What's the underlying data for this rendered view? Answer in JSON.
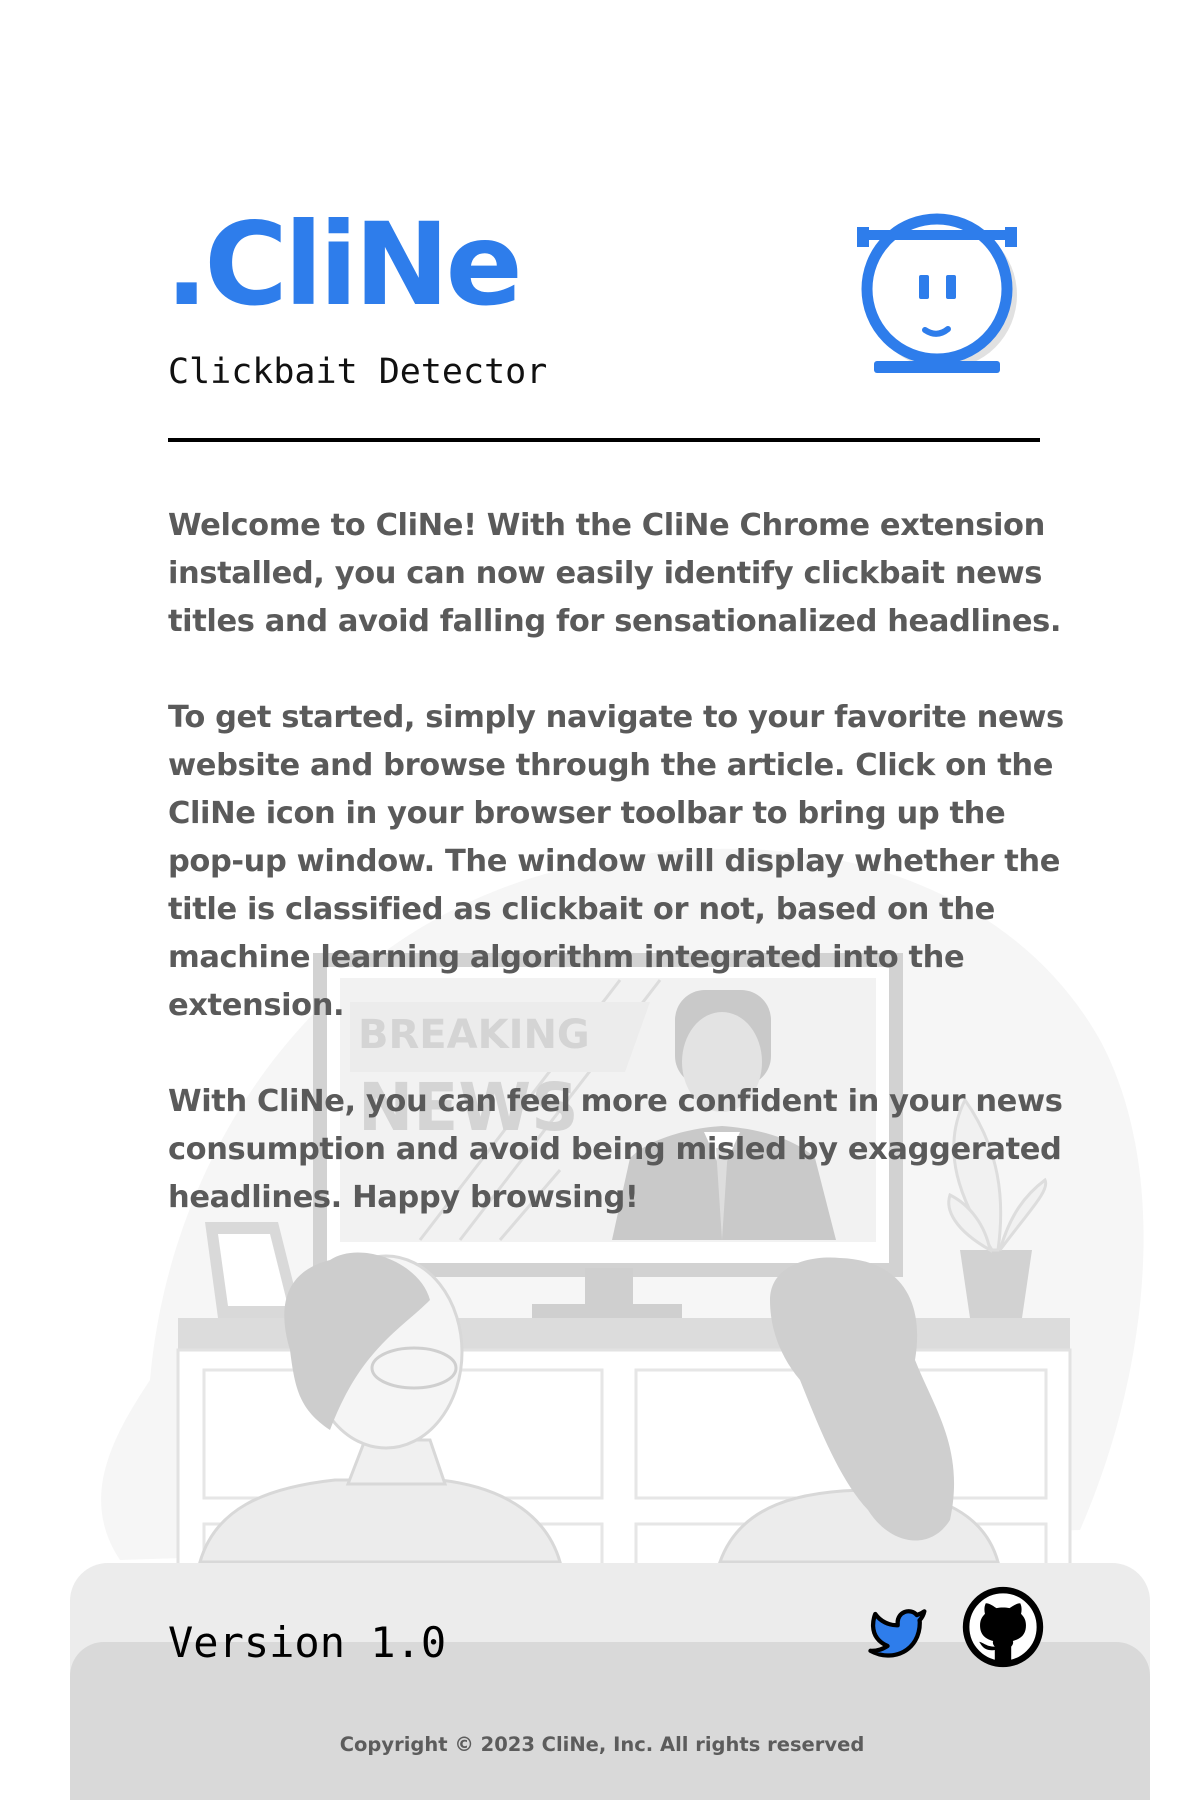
{
  "header": {
    "title": ".CliNe",
    "subtitle": "Clickbait Detector"
  },
  "illustration": {
    "banner_line1": "BREAKING",
    "banner_line2": "NEWS"
  },
  "content": {
    "paragraphs": [
      "Welcome to CliNe! With the CliNe Chrome extension installed, you can now easily identify clickbait news titles and avoid falling for sensationalized headlines.",
      "To get started, simply navigate to your favorite news website and browse through the article. Click on the CliNe icon in your browser toolbar to bring up the pop-up window. The window will display whether the title is classified as clickbait or not, based on the machine learning algorithm integrated into the extension.",
      "With CliNe, you can feel more confident in your news consumption and avoid being misled by exaggerated headlines. Happy browsing!"
    ]
  },
  "footer": {
    "version": "Version 1.0",
    "copyright": "Copyright © 2023 CliNe, Inc. All rights reserved",
    "social": [
      {
        "icon": "twitter-icon"
      },
      {
        "icon": "github-icon"
      }
    ]
  },
  "colors": {
    "brand": "#2e7deb",
    "body_text": "#5a5a5a",
    "footer_light": "#ececec",
    "footer_dark": "#d9d9d9"
  }
}
